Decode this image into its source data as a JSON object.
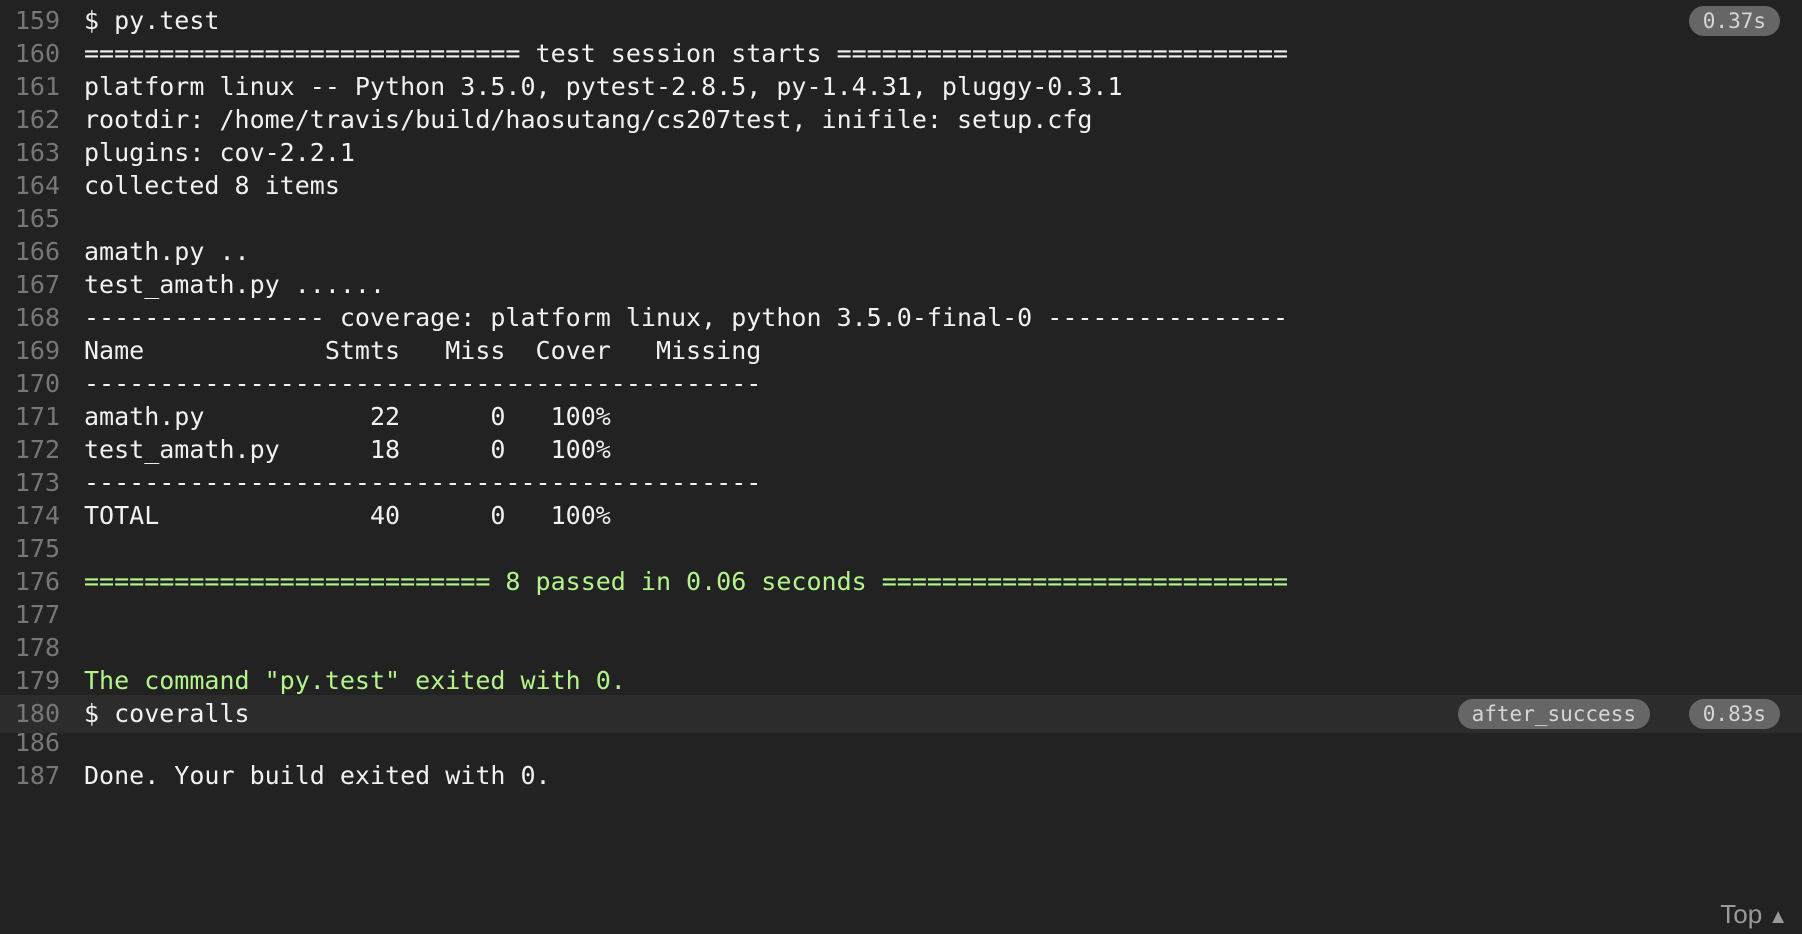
{
  "log": {
    "lines": [
      {
        "num": "159",
        "text": "$ py.test",
        "duration": "0.37s"
      },
      {
        "num": "160",
        "text": "============================= test session starts =============================="
      },
      {
        "num": "161",
        "text": "platform linux -- Python 3.5.0, pytest-2.8.5, py-1.4.31, pluggy-0.3.1"
      },
      {
        "num": "162",
        "text": "rootdir: /home/travis/build/haosutang/cs207test, inifile: setup.cfg"
      },
      {
        "num": "163",
        "text": "plugins: cov-2.2.1"
      },
      {
        "num": "164",
        "text": "collected 8 items"
      },
      {
        "num": "165",
        "text": ""
      },
      {
        "num": "166",
        "text": "amath.py .."
      },
      {
        "num": "167",
        "text": "test_amath.py ......"
      },
      {
        "num": "168",
        "text": "---------------- coverage: platform linux, python 3.5.0-final-0 ----------------"
      },
      {
        "num": "169",
        "text": "Name            Stmts   Miss  Cover   Missing"
      },
      {
        "num": "170",
        "text": "---------------------------------------------"
      },
      {
        "num": "171",
        "text": "amath.py           22      0   100%"
      },
      {
        "num": "172",
        "text": "test_amath.py      18      0   100%"
      },
      {
        "num": "173",
        "text": "---------------------------------------------"
      },
      {
        "num": "174",
        "text": "TOTAL              40      0   100%"
      },
      {
        "num": "175",
        "text": ""
      },
      {
        "num": "176",
        "text": "=========================== 8 passed in 0.06 seconds ===========================",
        "color": "green"
      },
      {
        "num": "177",
        "text": ""
      },
      {
        "num": "178",
        "text": ""
      },
      {
        "num": "179",
        "text": "The command \"py.test\" exited with 0.",
        "color": "green"
      },
      {
        "num": "180",
        "text": "$ coveralls",
        "stage": "after_success",
        "duration": "0.83s",
        "fold": true
      },
      {
        "num": "186",
        "text": ""
      },
      {
        "num": "187",
        "text": "Done. Your build exited with 0."
      }
    ]
  },
  "top_link": {
    "label": "Top",
    "icon": "caret-up-icon"
  },
  "colors": {
    "background": "#222222",
    "text": "#f1f1f1",
    "line_number": "#777777",
    "success_green": "#b3f58c",
    "badge": "#666666"
  }
}
